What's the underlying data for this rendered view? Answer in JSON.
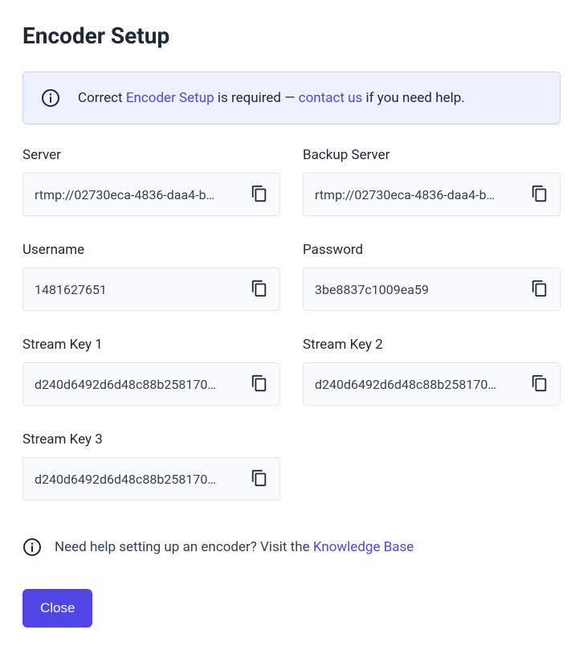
{
  "title": "Encoder Setup",
  "alert": {
    "prefix": "Correct ",
    "link1": "Encoder Setup",
    "middle": " is required — ",
    "link2": "contact us",
    "suffix": " if you need help."
  },
  "fields": {
    "server": {
      "label": "Server",
      "value": "rtmp://02730eca-4836-daa4-b…"
    },
    "backup_server": {
      "label": "Backup Server",
      "value": "rtmp://02730eca-4836-daa4-b…"
    },
    "username": {
      "label": "Username",
      "value": "1481627651"
    },
    "password": {
      "label": "Password",
      "value": "3be8837c1009ea59"
    },
    "stream_key_1": {
      "label": "Stream Key 1",
      "value": "d240d6492d6d48c88b258170…"
    },
    "stream_key_2": {
      "label": "Stream Key 2",
      "value": "d240d6492d6d48c88b258170…"
    },
    "stream_key_3": {
      "label": "Stream Key 3",
      "value": "d240d6492d6d48c88b258170…"
    }
  },
  "help": {
    "prefix": "Need help setting up an encoder? Visit the ",
    "link": "Knowledge Base"
  },
  "close_label": "Close",
  "colors": {
    "accent": "#4f46e5",
    "banner_bg": "#eef2ff",
    "banner_border": "#c7d2fe",
    "field_bg": "#f9fafb",
    "field_border": "#e5e7eb",
    "icon_dark": "#1f2937"
  }
}
